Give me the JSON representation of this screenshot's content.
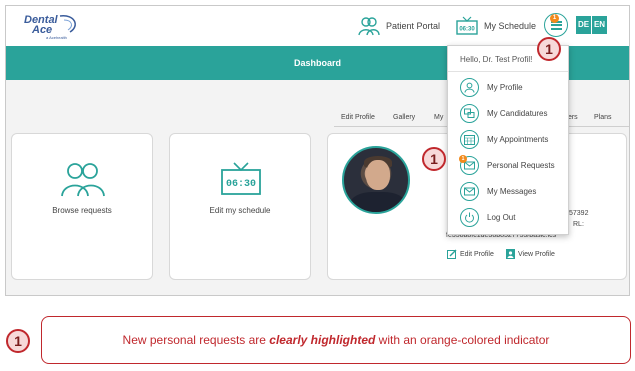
{
  "header": {
    "logo": {
      "line1": "Dental",
      "line2": "Ace",
      "line3": "a Acehealth"
    },
    "patient_portal_label": "Patient Portal",
    "my_schedule_label": "My Schedule",
    "schedule_icon_time": "06:30",
    "menu_badge": "1",
    "lang_de": "DE",
    "lang_en": "EN"
  },
  "dashboard": {
    "title": "Dashboard"
  },
  "tabs": [
    "Edit Profile",
    "Gallery",
    "My",
    "ters",
    "Plans"
  ],
  "cards": {
    "browse_label": "Browse requests",
    "schedule_label": "Edit my schedule",
    "schedule_time": "06:30"
  },
  "profile": {
    "partial_1": "57392",
    "partial_2": "RL:",
    "ics_url": "fe358a8fc1de38b8527755/basic.ics",
    "edit_profile": "Edit Profile",
    "view_profile": "View Profile"
  },
  "dropdown": {
    "greeting": "Hello, Dr. Test Profil!",
    "items": [
      {
        "label": "My Profile",
        "icon": "user-icon"
      },
      {
        "label": "My Candidatures",
        "icon": "candidatures-icon"
      },
      {
        "label": "My Appointments",
        "icon": "calendar-icon"
      },
      {
        "label": "Personal Requests",
        "icon": "mail-icon",
        "badge": "1"
      },
      {
        "label": "My Messages",
        "icon": "messages-icon"
      },
      {
        "label": "Log Out",
        "icon": "power-icon"
      }
    ]
  },
  "annotation": {
    "marker": "1",
    "text_before": "New personal requests are ",
    "text_highlight": "clearly highlighted",
    "text_after": " with an orange-colored indicator"
  },
  "colors": {
    "teal": "#2aa39a",
    "orange": "#f28a1c",
    "callout_red": "#c0282d"
  }
}
